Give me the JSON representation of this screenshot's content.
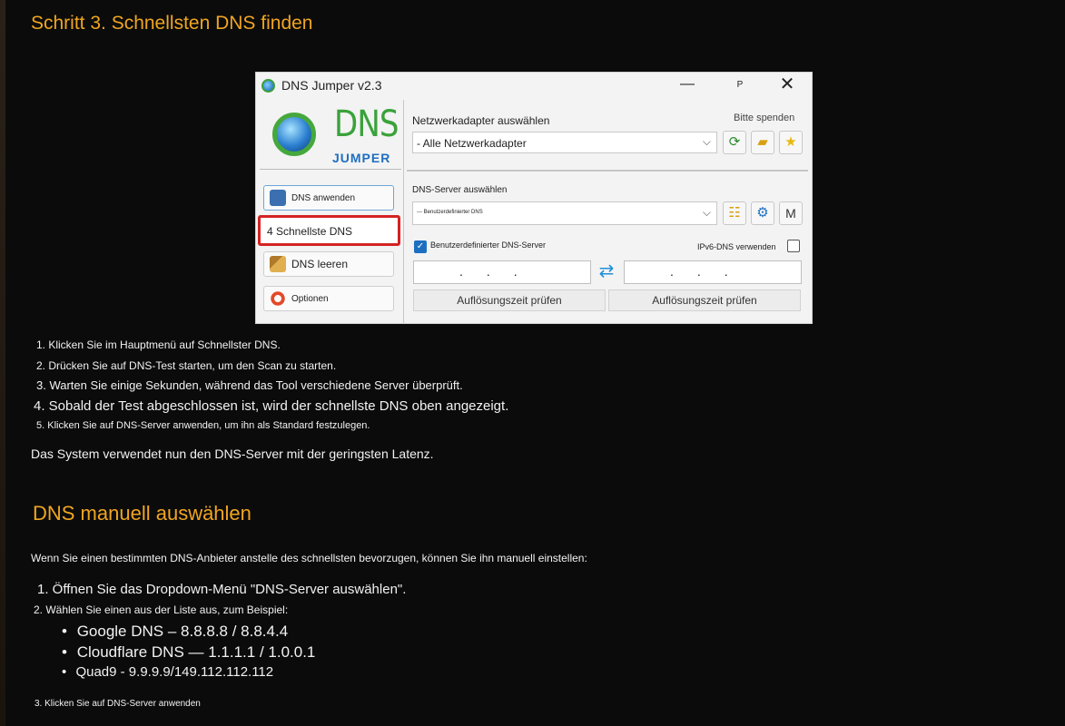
{
  "heading1": "Schritt 3. Schnellsten DNS finden",
  "app": {
    "title": "DNS Jumper v2.3",
    "minimize": "—",
    "pin": "P",
    "close": "✕",
    "logo_dns": "DNS",
    "logo_jumper": "JUMPER",
    "adapter_label": "Netzwerkadapter auswählen",
    "donate": "Bitte spenden",
    "adapter_value": "- Alle Netzwerkadapter",
    "buttons": {
      "apply": "DNS anwenden",
      "fastest": "4 Schnellste DNS",
      "flush": "DNS leeren",
      "options": "Optionen"
    },
    "dns_label": "DNS-Server auswählen",
    "dns_value": "--- Benutzerdefinierter DNS",
    "custom_label": "Benutzerdefinierter DNS-Server",
    "custom_checked": true,
    "ipv6_label": "IPv6-DNS verwenden",
    "ip1": "...",
    "ip2": "...",
    "check1": "Auflösungszeit prüfen",
    "check2": "Auflösungszeit prüfen",
    "m_button": "M",
    "icons": {
      "refresh": "refresh-icon",
      "folder": "folder-icon",
      "star": "star-icon",
      "list": "list-icon",
      "gear": "gear-icon",
      "swap": "swap-icon"
    }
  },
  "steps1": [
    "1. Klicken Sie im Hauptmenü auf Schnellster DNS.",
    "2. Drücken Sie auf DNS-Test starten, um den Scan zu starten.",
    "3. Warten Sie einige Sekunden, während das Tool verschiedene Server überprüft.",
    "4. Sobald der Test abgeschlossen ist, wird der schnellste DNS oben angezeigt.",
    "5. Klicken Sie auf DNS-Server anwenden, um ihn als Standard festzulegen."
  ],
  "para1": "Das System verwendet nun den DNS-Server mit der geringsten Latenz.",
  "heading2": "DNS manuell auswählen",
  "para2": "Wenn Sie einen bestimmten DNS-Anbieter anstelle des schnellsten bevorzugen, können Sie ihn manuell einstellen:",
  "steps2": [
    "1. Öffnen Sie das Dropdown-Menü \"DNS-Server auswählen\".",
    "2. Wählen Sie einen aus der Liste aus, zum Beispiel:",
    "3. Klicken Sie auf DNS-Server anwenden"
  ],
  "examples": [
    "Google DNS – 8.8.8.8 / 8.8.4.4",
    "Cloudflare DNS — 1.1.1.1 / 1.0.0.1",
    "Quad9 - 9.9.9.9/149.112.112.112"
  ],
  "bullet": "•"
}
